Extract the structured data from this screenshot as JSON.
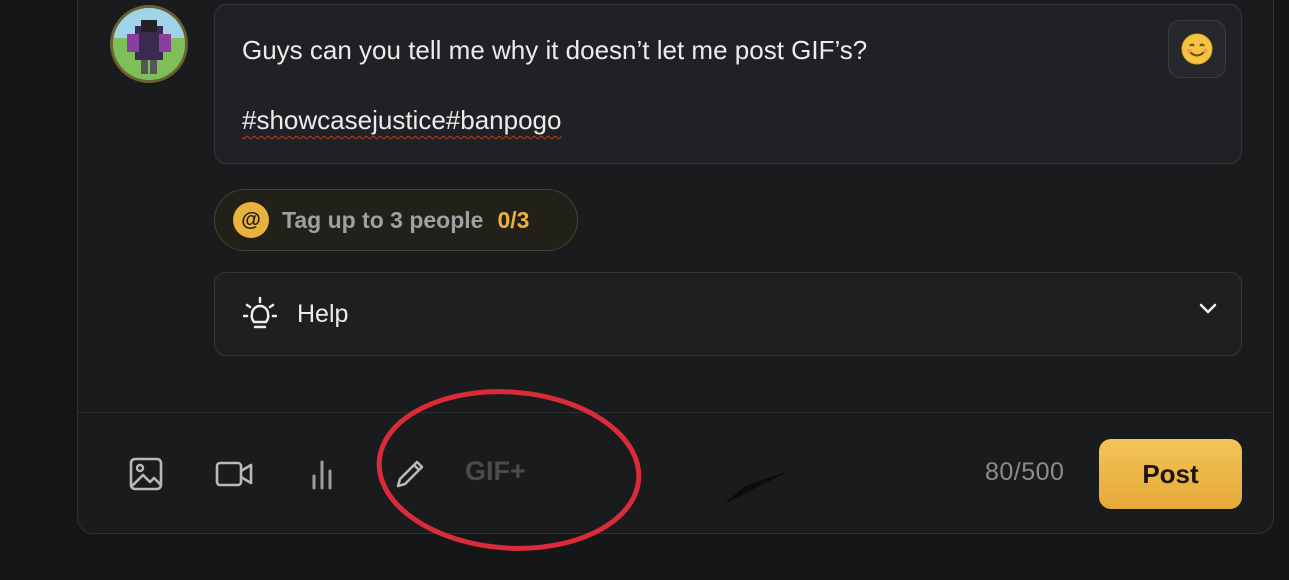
{
  "composer": {
    "message_line1": "Guys can you tell me why it doesn’t let me post GIF’s?",
    "message_line2": "#showcasejustice#banpogo",
    "emoji_icon": "smile-emoji-icon"
  },
  "tagging": {
    "icon_glyph": "@",
    "label": "Tag up to 3 people",
    "count": "0/3"
  },
  "help": {
    "label": "Help"
  },
  "toolbar": {
    "icons": [
      "image-icon",
      "video-icon",
      "poll-icon",
      "pencil-icon"
    ],
    "gif_label": "GIF+",
    "counter": "80/500",
    "post_label": "Post"
  },
  "colors": {
    "accent": "#e8b23c",
    "background": "#151617",
    "annotation": "#d92b38"
  }
}
